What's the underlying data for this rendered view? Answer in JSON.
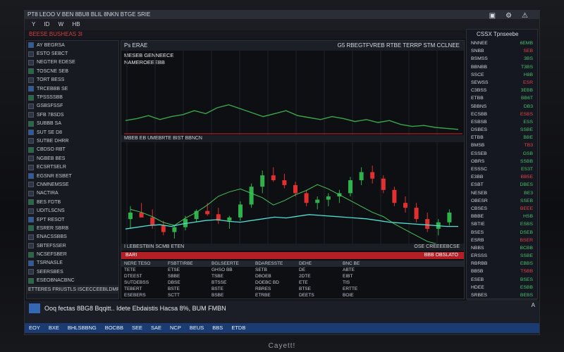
{
  "window": {
    "title": "PT8 LEOO V BEN 8BU8 BLIL 8NKN BTGE SRIE",
    "icons": [
      "monitor-icon",
      "settings-icon",
      "alert-icon"
    ]
  },
  "menubar": {
    "items": [
      "Y",
      "ID",
      "W",
      "HB"
    ]
  },
  "toolbar": {
    "red_label": "BEESE BUSHEAS 3I"
  },
  "left_panel": {
    "rows": [
      "AY BEGRSA",
      "ESTO SEBCT",
      "NEGTER EDESE",
      "TOSCNE SEB",
      "TORT BESS",
      "TRCEBBB SE",
      "TPSSSSBB",
      "GSBSFSSF",
      "SFB 7BSDS",
      "SUBBB SA",
      "SUT SE D8",
      "SUTBE DHRR",
      "CBDSO RBT",
      "NGBEB BES",
      "ECSRTSELR",
      "EGSNR ESBET",
      "CNMNEMSSE",
      "NACTIRA",
      "BES FDTB",
      "UDITLSCNS",
      "EPT RESOT",
      "ESRER SBRB",
      "ENACSSBBS",
      "SBTEFSSER",
      "NCSEFSBER",
      "TSRNASLE",
      "SEERSBES",
      "ESEOBNACBNC"
    ],
    "footer": "ETTERES FRIUSTLS ISCECCEEBLDMR"
  },
  "chart": {
    "header_left": "Ps ERAE",
    "header_right": "G5 RBEGTFVREB RTBE TERRP STM CCLNEE",
    "sub1": "MESEB GENNEECE",
    "sub2": "NAMEROEEEBB",
    "indicator_label": "MBEB EB UMEBRTE BIST BBNCN",
    "status_left": "I LEBESTBIN SCMB ETEN",
    "status_right": "OSE CREEEEBCSE",
    "redbar_left": "BARI",
    "redbar_right": "BBB OBSLATO",
    "order_header": [
      "NERE TESO",
      "FSBTTIRBE",
      "BGLSEERTE",
      "BDARESSTE",
      "DEHE",
      "BNC BE"
    ],
    "order_rows": [
      [
        "TETE",
        "ETSE",
        "GHSO BB",
        "SETB",
        "DE",
        "ABTE"
      ],
      [
        "DTEEST",
        "SBBE",
        "TSBE",
        "DBOEB",
        "2DTE",
        "EIBT"
      ],
      [
        "SUTDEBSS",
        "DBSE",
        "BTSSE",
        "DOEBC BD",
        "ETE",
        "TIS"
      ],
      [
        "TEBERT",
        "BSTE",
        "BSTE",
        "RBRES",
        "BTSE",
        "ERTTE"
      ],
      [
        "ESEBERS",
        "SCTT",
        "BSBE",
        "ETRBE",
        "DEETS",
        "BOIE"
      ]
    ]
  },
  "chart_data": {
    "type": "line",
    "series": [
      {
        "values": [
          42,
          44,
          47,
          43,
          46,
          48,
          52,
          49,
          55,
          58,
          54,
          50,
          46,
          49,
          52,
          47,
          45,
          43,
          46,
          44,
          41,
          43,
          40,
          42,
          38,
          36,
          37,
          35,
          34,
          33
        ]
      },
      {
        "values": [
          60,
          58,
          55,
          51,
          49,
          54,
          58,
          63,
          69,
          72,
          74,
          71,
          68,
          63,
          66,
          70,
          73,
          77,
          74,
          70,
          66,
          62,
          58,
          55,
          50,
          46,
          42,
          38,
          36,
          34
        ]
      },
      {
        "values": [
          14,
          16,
          18,
          19,
          17,
          20,
          22,
          24,
          25,
          23,
          22,
          24,
          26,
          28,
          27,
          29,
          31,
          30,
          29,
          28,
          27,
          26,
          24,
          22,
          21,
          20,
          19,
          18,
          17,
          17
        ]
      }
    ],
    "candles": [
      [
        56,
        64,
        50,
        60
      ],
      [
        60,
        66,
        58,
        57
      ],
      [
        57,
        62,
        50,
        52
      ],
      [
        52,
        55,
        46,
        48
      ],
      [
        48,
        52,
        44,
        51
      ],
      [
        51,
        58,
        49,
        56
      ],
      [
        56,
        62,
        54,
        61
      ],
      [
        61,
        66,
        58,
        59
      ],
      [
        59,
        63,
        53,
        55
      ],
      [
        55,
        58,
        50,
        57
      ],
      [
        57,
        67,
        55,
        65
      ],
      [
        65,
        78,
        63,
        76
      ],
      [
        76,
        86,
        72,
        83
      ],
      [
        83,
        88,
        79,
        80
      ],
      [
        80,
        84,
        75,
        77
      ],
      [
        77,
        79,
        70,
        72
      ],
      [
        72,
        74,
        64,
        66
      ],
      [
        66,
        70,
        62,
        68
      ],
      [
        68,
        72,
        64,
        70
      ],
      [
        70,
        74,
        66,
        72
      ],
      [
        72,
        82,
        70,
        80
      ],
      [
        80,
        88,
        77,
        85
      ],
      [
        85,
        89,
        78,
        81
      ],
      [
        81,
        83,
        72,
        74
      ],
      [
        74,
        76,
        64,
        66
      ],
      [
        66,
        70,
        60,
        63
      ],
      [
        63,
        66,
        54,
        56
      ],
      [
        56,
        60,
        48,
        50
      ],
      [
        50,
        56,
        46,
        54
      ],
      [
        54,
        62,
        52,
        60
      ]
    ],
    "grid": true
  },
  "right_panel": {
    "title": "CSSX Tpnseebe",
    "rows": [
      [
        "NNNEE",
        "6EMB"
      ],
      [
        "SNBB",
        "SEB"
      ],
      [
        "BSMSS",
        "3BS"
      ],
      [
        "BBNBB",
        "T3BS"
      ],
      [
        "SSCE",
        "H8B"
      ],
      [
        "SEWSS",
        "ESR"
      ],
      [
        "C3BSS",
        "3EBB"
      ],
      [
        "ETBB",
        "BB6T"
      ],
      [
        "5BBNS",
        "DB3"
      ],
      [
        "ECSBB",
        "ESBS"
      ],
      [
        "ESBSB",
        "ESS"
      ],
      [
        "DSBES",
        "SSBE"
      ],
      [
        "ETBB",
        "BBE"
      ],
      [
        "BMSB",
        "TB3"
      ],
      [
        "ESSEB",
        "GSB"
      ],
      [
        "OBRS",
        "SSBB"
      ],
      [
        "ESSSC",
        "ES3T"
      ],
      [
        "E3BB",
        "BB5E"
      ],
      [
        "ESBT",
        "DBES"
      ],
      [
        "NESEB",
        "BE3"
      ],
      [
        "OBESR",
        "SSEB"
      ],
      [
        "CBSES",
        "BEEE"
      ],
      [
        "BBBE",
        "HSB"
      ],
      [
        "SBTIE",
        "ESBS"
      ],
      [
        "BSES",
        "DSEB"
      ],
      [
        "ESRB",
        "BSER"
      ],
      [
        "NBBS",
        "BCBB"
      ],
      [
        "ERSSS",
        "SSBE"
      ],
      [
        "RBRBB",
        "EBBS"
      ],
      [
        "BB5B",
        "TSBB"
      ],
      [
        "ESEB",
        "BSES"
      ],
      [
        "HDEE",
        "ESBB"
      ],
      [
        "SRBES",
        "BEBS"
      ]
    ],
    "footer": "ELTSTUBYE"
  },
  "bottom": {
    "news": "Ooq fectas 8BG8 Bqqitt.. Idete Ebdaistis Hacsa 8%, BUM FMBN",
    "news_sub": "OEOM",
    "right_icon": "A",
    "tabs": [
      "EOY",
      "BXE",
      "BHLSBBNG",
      "BOCBB",
      "SEE",
      "SAE",
      "NCP",
      "BEUS",
      "BBS",
      "ETDB"
    ]
  },
  "device": {
    "brand": "Cayett!"
  },
  "colors": {
    "up": "#2fb24c",
    "down": "#e23030",
    "line_green": "#3aa64c",
    "line_teal": "#4fe0d2",
    "line_green2": "#48c25a",
    "accent_red": "#b21f24"
  }
}
